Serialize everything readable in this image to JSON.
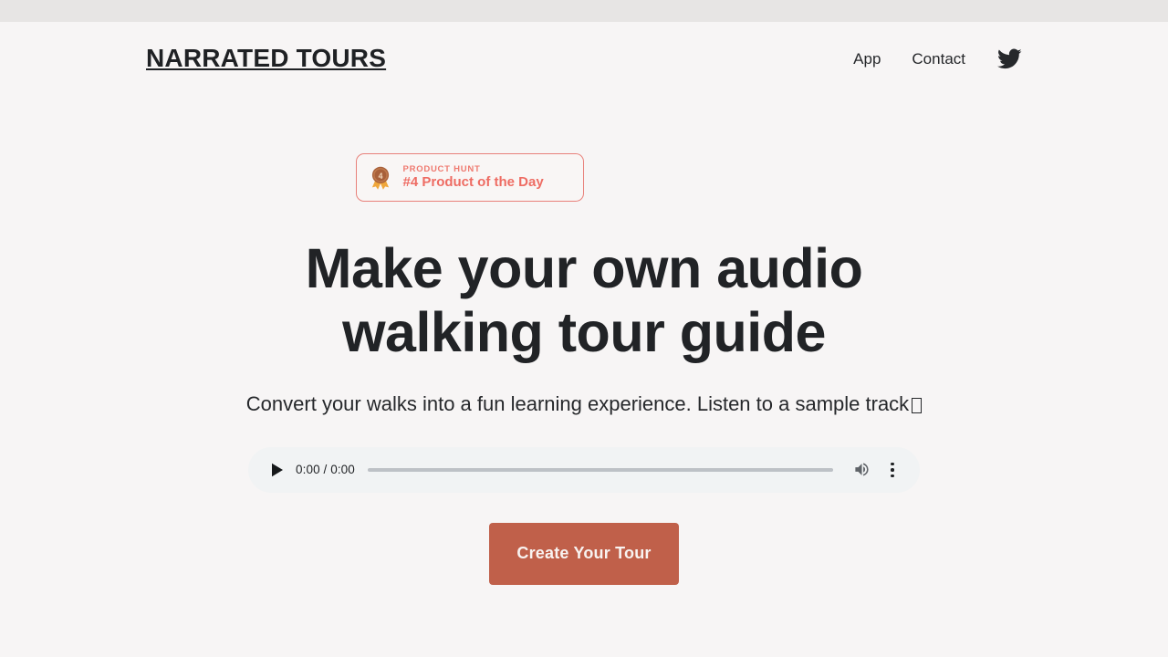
{
  "header": {
    "brand": "NARRATED TOURS",
    "nav": [
      {
        "label": "App",
        "name": "nav-link-app"
      },
      {
        "label": "Contact",
        "name": "nav-link-contact"
      }
    ],
    "social_icon": "twitter-icon"
  },
  "badge": {
    "icon": "medal-icon",
    "medal_rank": "4",
    "kicker": "PRODUCT HUNT",
    "title": "#4 Product of the Day",
    "border_color": "#e8807a",
    "text_color": "#ee6c63"
  },
  "hero": {
    "headline": "Make your own audio walking tour guide",
    "subhead": "Convert your walks into a fun learning experience. Listen to a sample track",
    "subhead_trailing_glyph": "missing-glyph"
  },
  "audio_player": {
    "play_icon": "play-icon",
    "time_display": "0:00 / 0:00",
    "current_time": "0:00",
    "duration": "0:00",
    "progress_percent": 0,
    "volume_icon": "volume-icon",
    "menu_icon": "more-vertical-icon",
    "background_color": "#f1f3f4"
  },
  "cta": {
    "label": "Create Your Tour",
    "background_color": "#c0604a",
    "text_color": "#f8f3f1"
  },
  "theme": {
    "page_background": "#f7f5f5",
    "browser_strip": "#e7e5e4",
    "text_color": "#1f2124"
  }
}
